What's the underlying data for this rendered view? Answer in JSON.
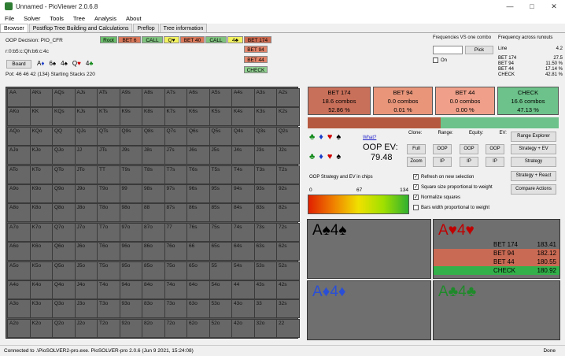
{
  "window": {
    "title": "Unnamed - PioViewer 2.0.6.8",
    "min": "—",
    "max": "□",
    "close": "✕"
  },
  "menu": [
    "File",
    "Solver",
    "Tools",
    "Tree",
    "Analysis",
    "About"
  ],
  "tabs": [
    "Browser",
    "Postflop Tree Building and Calculations",
    "Preflop",
    "Tree information"
  ],
  "info": {
    "decision": "OOP Decision:  PIO_CFR",
    "line": "r:0:b5:c:Qh:b6:c:4c",
    "board_label": "Board",
    "board_cards": [
      {
        "rank": "A",
        "suit": "♦",
        "color": "#1a3cc8"
      },
      {
        "rank": "6",
        "suit": "♠",
        "color": "#000"
      },
      {
        "rank": "4",
        "suit": "♠",
        "color": "#000"
      },
      {
        "rank": "Q",
        "suit": "♥",
        "color": "#d00000"
      },
      {
        "rank": "4",
        "suit": "♣",
        "color": "#138a1a"
      }
    ],
    "pot": "Pot: 46 46 42 (134) Starting Stacks 220"
  },
  "tree": {
    "row1": [
      "Root",
      "BET 6",
      "CALL",
      "Q♥",
      "BET 40",
      "CALL",
      "4♣",
      "BET 174"
    ],
    "row2": "BET 94",
    "row3": "BET 44",
    "row4": "CHECK"
  },
  "freq": {
    "label": "Frequencies VS one combo",
    "pick": "Pick",
    "on": "On",
    "across": "Frequency across runouts",
    "items": [
      {
        "k": "Line",
        "v": "4.2"
      },
      {
        "k": "BET 174",
        "v": "27.5"
      },
      {
        "k": "BET 94",
        "v": "11.50 %"
      },
      {
        "k": "BET 44",
        "v": "17.14 %"
      },
      {
        "k": "CHECK",
        "v": "42.81 %"
      }
    ]
  },
  "ranks": [
    "A",
    "K",
    "Q",
    "J",
    "T",
    "9",
    "8",
    "7",
    "6",
    "5",
    "4",
    "3",
    "2"
  ],
  "actions": [
    {
      "name": "BET 174",
      "combos": "18.6 combos",
      "pct": "52.86 %",
      "bg": "#c9705a"
    },
    {
      "name": "BET 94",
      "combos": "0.0 combos",
      "pct": "0.01 %",
      "bg": "#e8957a"
    },
    {
      "name": "BET 44",
      "combos": "0.0 combos",
      "pct": "0.00 %",
      "bg": "#f0a08a"
    },
    {
      "name": "CHECK",
      "combos": "16.6 combos",
      "pct": "47.13 %",
      "bg": "#6cc28a"
    }
  ],
  "suits": {
    "top": [
      "♣",
      "♦",
      "♥",
      "♠"
    ],
    "bottom": [
      "♣",
      "♦",
      "♥",
      "♠"
    ]
  },
  "what": "What?",
  "ev": {
    "label": "OOP EV:",
    "value": "79.48"
  },
  "controls": {
    "headers": [
      "Clone:",
      "Range:",
      "Equity:",
      "EV:"
    ],
    "row1": [
      "Full",
      "OOP",
      "OOP",
      "OOP"
    ],
    "row2": [
      "Zoom",
      "IP",
      "IP",
      "IP"
    ]
  },
  "rightbtns": [
    "Range Explorer",
    "Strategy + EV",
    "Strategy",
    "Strategy + React",
    "Compare Actions"
  ],
  "strategy_ev": "OOP Strategy and EV in chips",
  "scale": {
    "min": "0",
    "mid": "67",
    "max": "134"
  },
  "checks": [
    {
      "label": "Refresh on new selection",
      "on": true
    },
    {
      "label": "Square size proportional to weight",
      "on": true
    },
    {
      "label": "Normalize squares",
      "on": true
    },
    {
      "label": "Bars width proportional to weight",
      "on": false
    }
  ],
  "hands": {
    "tl": {
      "text": "A♠4♠",
      "color": "#000"
    },
    "tr": {
      "text": "A♥4♥",
      "color": "#c00000"
    },
    "bl": {
      "text": "A♦4♦",
      "color": "#2a4fd6"
    },
    "br": {
      "text": "A♣4♣",
      "color": "#1f8a2a"
    }
  },
  "evlist": [
    {
      "a": "BET 174",
      "v": "183.41",
      "bg": "#6f6f6f"
    },
    {
      "a": "BET 94",
      "v": "182.12",
      "bg": "#c96a54"
    },
    {
      "a": "BET 44",
      "v": "180.55",
      "bg": "#c96a54"
    },
    {
      "a": "CHECK",
      "v": "180.92",
      "bg": "#33b04a"
    }
  ],
  "status": {
    "text": "Connected to .\\PioSOLVER2-pro.exe. PioSOLVER-pro 2.0.6 (Jun  9 2021, 15:24:08)",
    "done": "Done"
  }
}
